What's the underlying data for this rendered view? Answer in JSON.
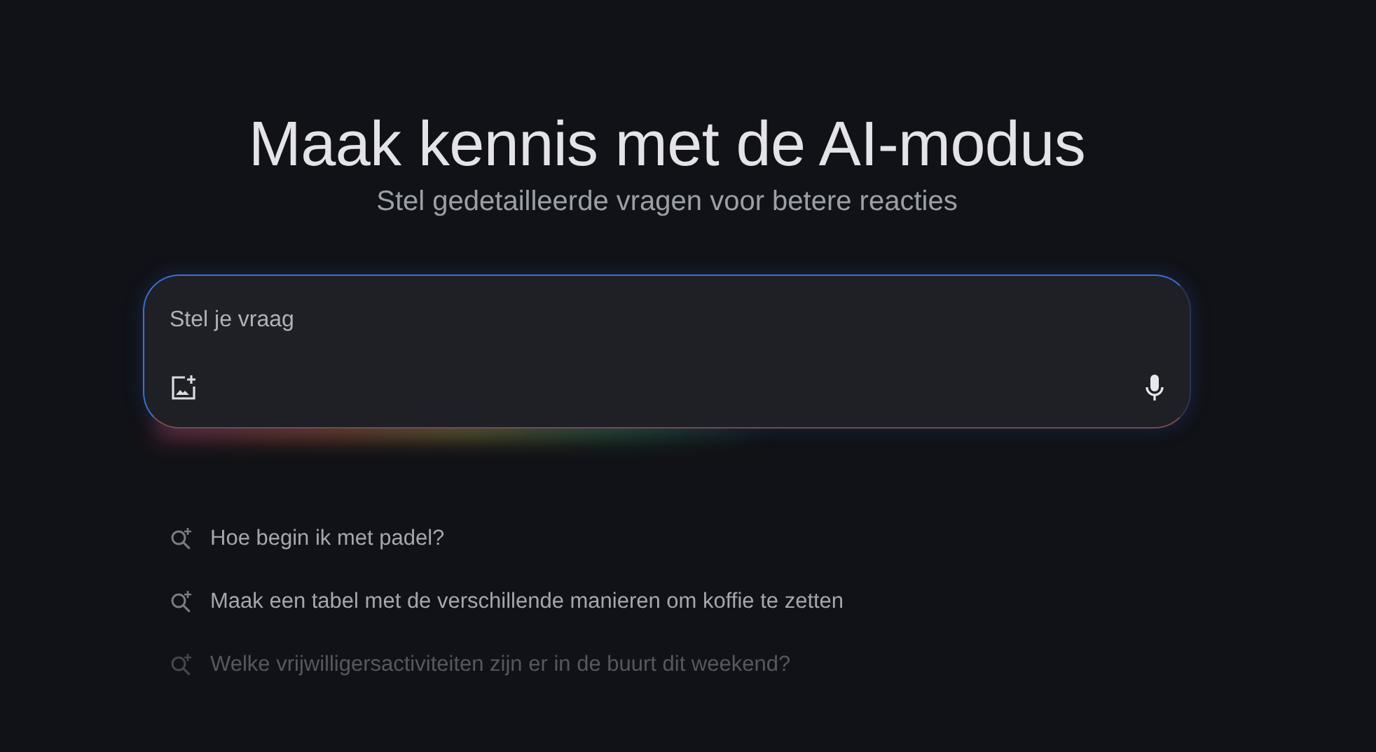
{
  "heading": {
    "title": "Maak kennis met de AI-modus",
    "subtitle": "Stel gedetailleerde vragen voor betere reacties"
  },
  "prompt_box": {
    "placeholder": "Stel je vraag"
  },
  "suggestions": [
    {
      "text": "Hoe begin ik met padel?",
      "dimmed": false
    },
    {
      "text": "Maak een tabel met de verschillende manieren om koffie te zetten",
      "dimmed": false
    },
    {
      "text": "Welke vrijwilligersactiviteiten zijn er in de buurt dit weekend?",
      "dimmed": true
    }
  ]
}
